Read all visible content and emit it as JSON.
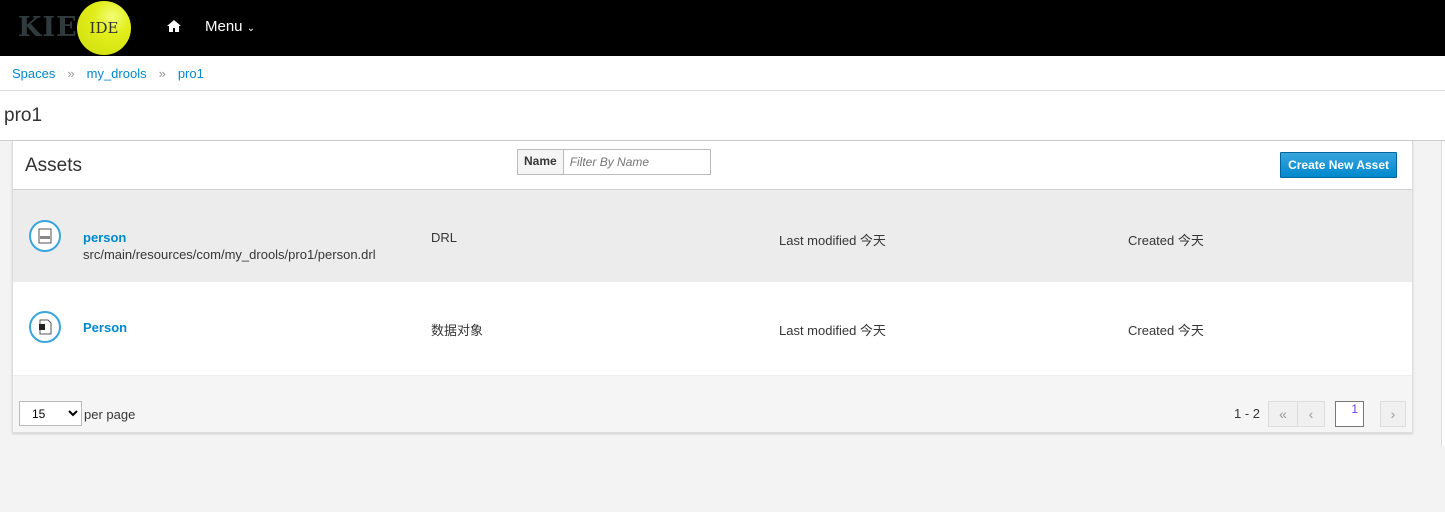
{
  "header": {
    "logo_text": "KIE",
    "logo_badge": "IDE",
    "menu_label": "Menu"
  },
  "breadcrumb": [
    "Spaces",
    "my_drools",
    "pro1"
  ],
  "page_title": "pro1",
  "assets": {
    "title": "Assets",
    "filter_label": "Name",
    "filter_placeholder": "Filter By Name",
    "create_button": "Create New Asset",
    "rows": [
      {
        "name": "person",
        "path": "src/main/resources/com/my_drools/pro1/person.drl",
        "type": "DRL",
        "modified": "Last modified 今天",
        "created": "Created 今天",
        "icon": "drl-file-icon"
      },
      {
        "name": "Person",
        "path": "",
        "type": "数据对象",
        "modified": "Last modified 今天",
        "created": "Created 今天",
        "icon": "data-object-icon"
      }
    ],
    "per_page_value": "15",
    "per_page_label": "per page",
    "range": "1 - 2",
    "current_page": "1"
  },
  "colors": {
    "accent": "#0088ce",
    "topbar": "#000000",
    "logo_ball": "#e1ee1a"
  }
}
